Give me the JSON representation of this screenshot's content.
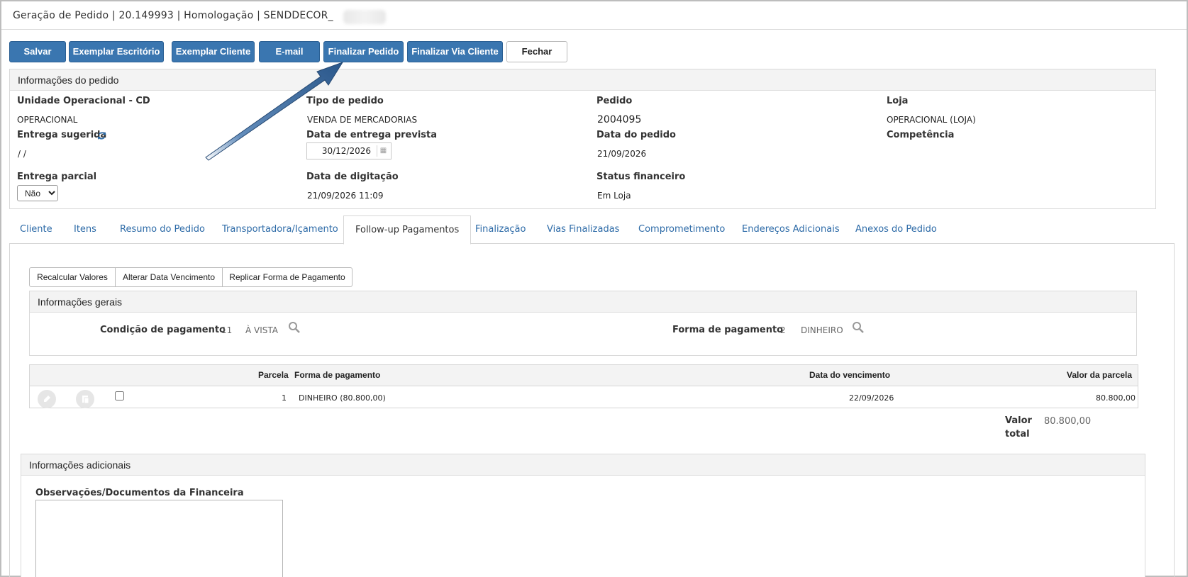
{
  "window": {
    "title": "Geração de Pedido | 20.149993 | Homologação | SENDDECOR_"
  },
  "toolbar": {
    "buttons": [
      {
        "label": "Salvar"
      },
      {
        "label": "Exemplar Escritório"
      },
      {
        "label": "Exemplar Cliente"
      },
      {
        "label": "E-mail"
      },
      {
        "label": "Finalizar Pedido"
      },
      {
        "label": "Finalizar Via Cliente"
      },
      {
        "label": "Fechar"
      }
    ]
  },
  "order_info": {
    "heading": "Informações do pedido",
    "unidade_label": "Unidade Operacional - CD",
    "unidade_value": "OPERACIONAL",
    "tipo_label": "Tipo de pedido",
    "tipo_value": "VENDA DE MERCADORIAS",
    "pedido_label": "Pedido",
    "pedido_value": "2004095",
    "loja_label": "Loja",
    "loja_value": "OPERACIONAL (LOJA)",
    "entrega_sugerida_label": "Entrega sugerida",
    "entrega_sugerida_value": "/ /",
    "data_entrega_label": "Data de entrega prevista",
    "data_entrega_value": "30/12/2026",
    "data_pedido_label": "Data do pedido",
    "data_pedido_value": "21/09/2026",
    "competencia_label": "Competência",
    "entrega_parcial_label": "Entrega parcial",
    "entrega_parcial_value": "Não",
    "data_digitacao_label": "Data de digitação",
    "data_digitacao_value": "21/09/2026 11:09",
    "status_label": "Status financeiro",
    "status_value": "Em Loja"
  },
  "tabs": [
    {
      "label": "Cliente"
    },
    {
      "label": "Itens"
    },
    {
      "label": "Resumo do Pedido"
    },
    {
      "label": "Transportadora/Içamento"
    },
    {
      "label": "Follow-up Pagamentos"
    },
    {
      "label": "Finalização"
    },
    {
      "label": "Vias Finalizadas"
    },
    {
      "label": "Comprometimento"
    },
    {
      "label": "Endereços Adicionais"
    },
    {
      "label": "Anexos do Pedido"
    }
  ],
  "active_tab": "Follow-up Pagamentos",
  "sub_toolbar": {
    "buttons": [
      {
        "label": "Recalcular Valores"
      },
      {
        "label": "Alterar Data Vencimento"
      },
      {
        "label": "Replicar Forma de Pagamento"
      }
    ]
  },
  "general_info": {
    "heading": "Informações gerais",
    "condicao_label": "Condição de pagamento",
    "condicao_code": "11",
    "condicao_value": "À VISTA",
    "forma_label": "Forma de pagamento",
    "forma_code": "2",
    "forma_value": "DINHEIRO"
  },
  "payments_table": {
    "headers": {
      "parcela": "Parcela",
      "forma": "Forma de pagamento",
      "data": "Data do vencimento",
      "valor": "Valor da parcela"
    },
    "rows": [
      {
        "parcela": "1",
        "forma": "DINHEIRO (80.800,00)",
        "data": "22/09/2026",
        "valor": "80.800,00"
      }
    ]
  },
  "total": {
    "label_line1": "Valor",
    "label_line2": "total",
    "value": "80.800,00"
  },
  "additional_info": {
    "heading": "Informações adicionais",
    "obs_label": "Observações/Documentos da Financeira"
  },
  "colors": {
    "primary_button": "#3a76b0",
    "link": "#2c6aa7",
    "arrow": "#1f4f85"
  },
  "icons": [
    "refresh-icon",
    "calendar-icon",
    "search-icon",
    "edit-icon",
    "copy-icon"
  ]
}
